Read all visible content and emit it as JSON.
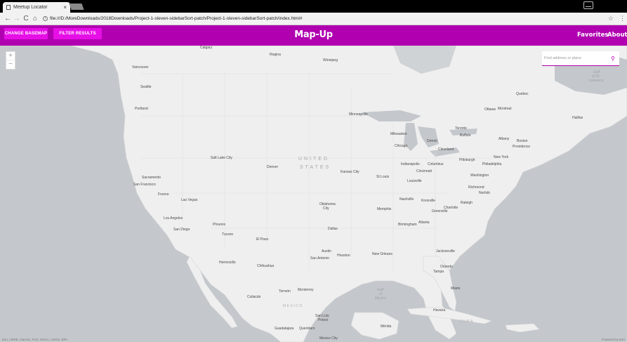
{
  "browser": {
    "tab_title": "Meetup Locator",
    "tab_close": "×",
    "url": "file:///D:/MoreDownloads/2018Downloads/Project-1-steven-sidebarSort-patch/Project-1-steven-sidebarSort-patch/index.html#",
    "back": "←",
    "forward": "→",
    "reload": "C",
    "home": "⌂",
    "star": "☆",
    "menu": "⋮"
  },
  "header": {
    "change_basemap": "CHANGE BASEMAP",
    "filter_results": "FILTER RESULTS",
    "title": "Map-Up",
    "favorites": "Favorites",
    "about": "About"
  },
  "map": {
    "zoom_in": "+",
    "zoom_out": "−",
    "search_placeholder": "Find address or place",
    "search_icon": "⚲",
    "attribution": "Esri, HERE, Garmin, FAO, NOAA, USGS, EPA",
    "powered": "Powered by Esri",
    "country_us_1": "UNITED",
    "country_us_2": "STATES",
    "country_mexico": "MEXICO",
    "water_gulf": "Gulf of Mexico",
    "water_gulf_a": "Gulf",
    "water_gulf_b": "of",
    "water_gulf_c": "Mexico",
    "water_st_lawrence_a": "Gulf",
    "water_st_lawrence_b": "of St.",
    "water_st_lawrence_c": "Lawrence",
    "cities": {
      "calgary": "Calgary",
      "regina": "Regina",
      "winnipeg": "Winnipeg",
      "vancouver": "Vancouver",
      "seattle": "Seattle",
      "portland": "Portland",
      "minneapolis": "Minneapolis",
      "quebec": "Quebec",
      "ottawa": "Ottawa",
      "montreal": "Montreal",
      "halifax": "Halifax",
      "toronto": "Toronto",
      "buffalo": "Buffalo",
      "albany": "Albany",
      "boston": "Boston",
      "providence": "Providence",
      "milwaukee": "Milwaukee",
      "detroit": "Detroit",
      "chicago": "Chicago",
      "cleveland": "Cleveland",
      "pittsburgh": "Pittsburgh",
      "new_york": "New York",
      "philadelphia": "Philadelphia",
      "salt_lake": "Salt Lake City",
      "denver": "Denver",
      "indianapolis": "Indianapolis",
      "columbus": "Columbus",
      "cincinnati": "Cincinnati",
      "washington": "Washington",
      "kansas_city": "Kansas City",
      "st_louis": "St Louis",
      "louisville": "Louisville",
      "richmond": "Richmond",
      "norfolk": "Norfolk",
      "sacramento": "Sacramento",
      "san_francisco": "San Francisco",
      "fresno": "Fresno",
      "las_vegas": "Las Vegas",
      "oklahoma_a": "Oklahoma",
      "oklahoma_b": "City",
      "nashville": "Nashville",
      "knoxville": "Knoxville",
      "raleigh": "Raleigh",
      "charlotte": "Charlotte",
      "greenville": "Greenville",
      "memphis": "Memphis",
      "atlanta": "Atlanta",
      "birmingham": "Birmingham",
      "los_angeles": "Los Angeles",
      "san_diego": "San Diego",
      "phoenix": "Phoenix",
      "tucson": "Tucson",
      "el_paso": "El Paso",
      "dallas": "Dallas",
      "austin": "Austin",
      "houston": "Houston",
      "san_antonio": "San Antonio",
      "new_orleans": "New Orleans",
      "jacksonville": "Jacksonville",
      "orlando": "Orlando",
      "tampa": "Tampa",
      "miami": "Miami",
      "hermosillo": "Hermosillo",
      "chihuahua": "Chihuahua",
      "torreon": "Torreón",
      "monterrey": "Monterrey",
      "culiacan": "Culiacán",
      "san_luis_a": "San Luis",
      "san_luis_b": "Potosí",
      "guadalajara": "Guadalajara",
      "queretaro": "Querétaro",
      "merida": "Mérida",
      "havana": "Havana",
      "cuba": "CUBA",
      "mexico_city": "Mexico City"
    }
  }
}
